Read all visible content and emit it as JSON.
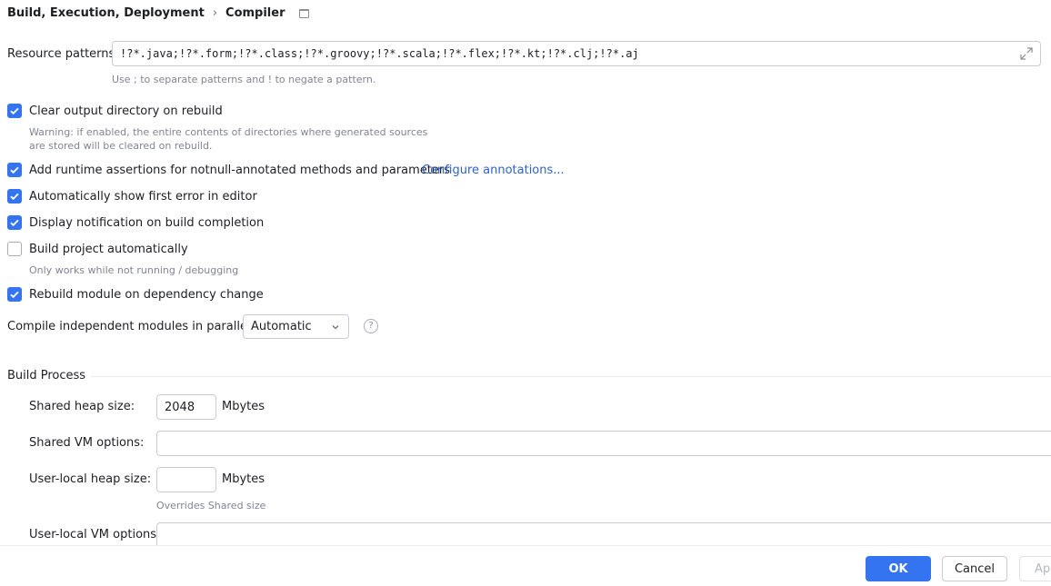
{
  "breadcrumb": {
    "parent": "Build, Execution, Deployment",
    "separator": "›",
    "current": "Compiler"
  },
  "resource_patterns": {
    "label": "Resource patterns:",
    "value": "!?*.java;!?*.form;!?*.class;!?*.groovy;!?*.scala;!?*.flex;!?*.kt;!?*.clj;!?*.aj",
    "hint": "Use ; to separate patterns and ! to negate a pattern."
  },
  "options": {
    "clear_output": {
      "label": "Clear output directory on rebuild",
      "checked": true,
      "warning_line1": "Warning: if enabled, the entire contents of directories where generated sources",
      "warning_line2": "are stored will be cleared on rebuild."
    },
    "runtime_assertions": {
      "label": "Add runtime assertions for notnull-annotated methods and parameters",
      "checked": true,
      "link": "Configure annotations..."
    },
    "show_first_error": {
      "label": "Automatically show first error in editor",
      "checked": true
    },
    "notify_build": {
      "label": "Display notification on build completion",
      "checked": true
    },
    "build_auto": {
      "label": "Build project automatically",
      "checked": false,
      "hint": "Only works while not running / debugging"
    },
    "rebuild_module": {
      "label": "Rebuild module on dependency change",
      "checked": true
    }
  },
  "parallel": {
    "label": "Compile independent modules in parallel:",
    "selected": "Automatic",
    "help_glyph": "?"
  },
  "build_process": {
    "title": "Build Process",
    "shared_heap": {
      "label": "Shared heap size:",
      "value": "2048",
      "unit": "Mbytes"
    },
    "shared_vm": {
      "label": "Shared VM options:",
      "value": ""
    },
    "user_heap": {
      "label": "User-local heap size:",
      "value": "",
      "unit": "Mbytes",
      "hint": "Overrides Shared size"
    },
    "user_vm": {
      "label": "User-local VM options:",
      "value": ""
    }
  },
  "footer": {
    "ok": "OK",
    "cancel": "Cancel",
    "apply": "Ap"
  },
  "colors": {
    "accent": "#3574f0",
    "link": "#2f62c9",
    "hint": "#818594"
  }
}
